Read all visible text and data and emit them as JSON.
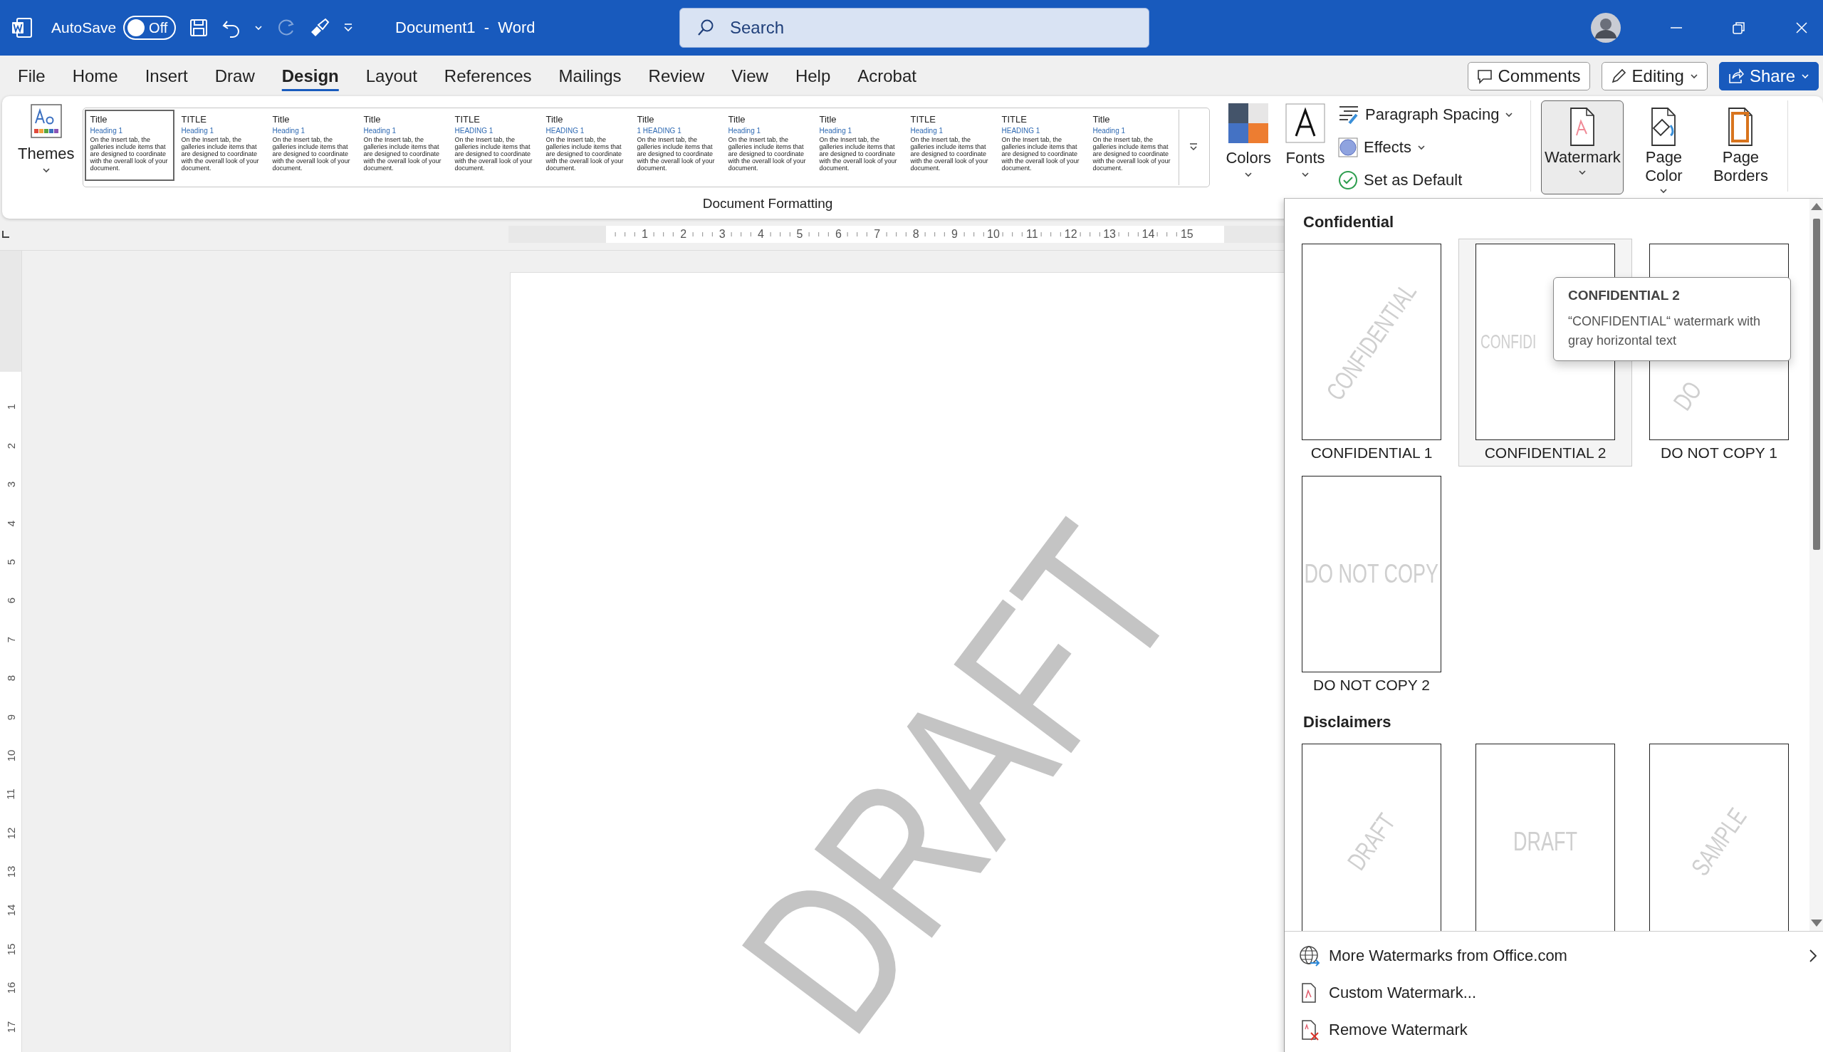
{
  "title_bar": {
    "autosave_label": "AutoSave",
    "autosave": {
      "label": "Off",
      "on": false
    },
    "redo_disabled": true,
    "document_title": "Document1  -  Word",
    "search": {
      "placeholder": "Search"
    }
  },
  "menu_tabs": [
    {
      "label": "File",
      "selected": false
    },
    {
      "label": "Home",
      "selected": false
    },
    {
      "label": "Insert",
      "selected": false
    },
    {
      "label": "Draw",
      "selected": false
    },
    {
      "label": "Design",
      "selected": true
    },
    {
      "label": "Layout",
      "selected": false
    },
    {
      "label": "References",
      "selected": false
    },
    {
      "label": "Mailings",
      "selected": false
    },
    {
      "label": "Review",
      "selected": false
    },
    {
      "label": "View",
      "selected": false
    },
    {
      "label": "Help",
      "selected": false
    },
    {
      "label": "Acrobat",
      "selected": false
    }
  ],
  "header_buttons": [
    {
      "label": "Comments",
      "kind": "comments"
    },
    {
      "label": "Editing",
      "kind": "editing"
    },
    {
      "label": "Share",
      "kind": "share"
    }
  ],
  "ribbon": {
    "themes": {
      "label": "Themes"
    },
    "style_gallery": [
      {
        "title": "Title",
        "heading": "Heading 1",
        "body": "On the Insert tab, the galleries include items that are designed to coordinate with the overall look of your document.",
        "selected": true
      },
      {
        "title": "TITLE",
        "heading": "Heading 1",
        "body": "On the Insert tab, the galleries include items that are designed to coordinate with the overall look of your document.",
        "selected": false
      },
      {
        "title": "Title",
        "heading": "Heading 1",
        "body": "On the Insert tab, the galleries include items that are designed to coordinate with the overall look of your document.",
        "selected": false
      },
      {
        "title": "Title",
        "heading": "Heading 1",
        "body": "On the Insert tab, the galleries include items that are designed to coordinate with the overall look of your document.",
        "selected": false
      },
      {
        "title": "TITLE",
        "heading": "HEADING 1",
        "body": "On the Insert tab, the galleries include items that are designed to coordinate with the overall look of your document.",
        "selected": false
      },
      {
        "title": "Title",
        "heading": "HEADING 1",
        "body": "On the Insert tab, the galleries include items that are designed to coordinate with the overall look of your document.",
        "selected": false
      },
      {
        "title": "Title",
        "heading": "1 HEADING 1",
        "body": "On the Insert tab, the galleries include items that are designed to coordinate with the overall look of your document.",
        "selected": false
      },
      {
        "title": "Title",
        "heading": "Heading 1",
        "body": "On the Insert tab, the galleries include items that are designed to coordinate with the overall look of your document.",
        "selected": false
      },
      {
        "title": "Title",
        "heading": "Heading 1",
        "body": "On the Insert tab, the galleries include items that are designed to coordinate with the overall look of your document.",
        "selected": false
      },
      {
        "title": "TITLE",
        "heading": "Heading 1",
        "body": "On the Insert tab, the galleries include items that are designed to coordinate with the overall look of your document.",
        "selected": false
      },
      {
        "title": "TITLE",
        "heading": "HEADING 1",
        "body": "On the Insert tab, the galleries include items that are designed to coordinate with the overall look of your document.",
        "selected": false
      },
      {
        "title": "Title",
        "heading": "Heading 1",
        "body": "On the Insert tab, the galleries include items that are designed to coordinate with the overall look of your document.",
        "selected": false
      }
    ],
    "theme_buttons": [
      {
        "label": "Colors",
        "kind": "colors"
      },
      {
        "label": "Fonts",
        "kind": "fonts"
      }
    ],
    "format_items": [
      {
        "label": "Paragraph Spacing",
        "kind": "spacing",
        "dropdown": true
      },
      {
        "label": "Effects",
        "kind": "effects",
        "dropdown": true
      },
      {
        "label": "Set as Default",
        "kind": "default",
        "dropdown": false
      }
    ],
    "page_buttons": [
      {
        "label": "Watermark",
        "kind": "watermark",
        "pressed": true
      },
      {
        "label": "Page Color",
        "kind": "color",
        "pressed": false
      },
      {
        "label": "Page Borders",
        "kind": "borders",
        "pressed": false
      }
    ],
    "group_label": "Document Formatting"
  },
  "ruler": {
    "horizontal": [
      "1",
      "2",
      "3",
      "4",
      "5",
      "6",
      "7",
      "8",
      "9",
      "10",
      "11",
      "12",
      "13",
      "14",
      "15"
    ],
    "vertical": [
      "1",
      "2",
      "3",
      "4",
      "5",
      "6",
      "7",
      "8",
      "9",
      "10",
      "11",
      "12",
      "13",
      "14",
      "15",
      "16",
      "17"
    ]
  },
  "document": {
    "watermark_text": "DRAFT"
  },
  "watermark_menu": {
    "sections": [
      {
        "heading": "Confidential",
        "items": [
          {
            "label": "CONFIDENTIAL 1",
            "preview": "CONFIDENTIAL",
            "kind": "diagonal",
            "highlighted": false
          },
          {
            "label": "CONFIDENTIAL 2",
            "preview": "CONFIDI",
            "kind": "horizontal-clipped",
            "highlighted": true
          },
          {
            "label": "DO NOT COPY 1",
            "preview": "DO",
            "kind": "diagonal-clipped",
            "highlighted": false
          },
          {
            "label": "DO NOT COPY 2",
            "preview": "DO NOT COPY",
            "kind": "horizontal",
            "highlighted": false
          }
        ]
      },
      {
        "heading": "Disclaimers",
        "items": [
          {
            "preview": "DRAFT",
            "kind": "diagonal",
            "highlighted": false
          },
          {
            "preview": "DRAFT",
            "kind": "horizontal",
            "highlighted": false
          },
          {
            "preview": "SAMPLE",
            "kind": "diagonal",
            "highlighted": false
          }
        ]
      }
    ],
    "tooltip": {
      "title": "CONFIDENTIAL 2",
      "text": "“CONFIDENTIAL“ watermark with gray horizontal text"
    },
    "commands": [
      {
        "label": "More Watermarks from Office.com",
        "kind": "web",
        "submenu": true
      },
      {
        "label": "Custom Watermark...",
        "kind": "custom",
        "submenu": false
      },
      {
        "label": "Remove Watermark",
        "kind": "remove",
        "submenu": false
      }
    ]
  }
}
